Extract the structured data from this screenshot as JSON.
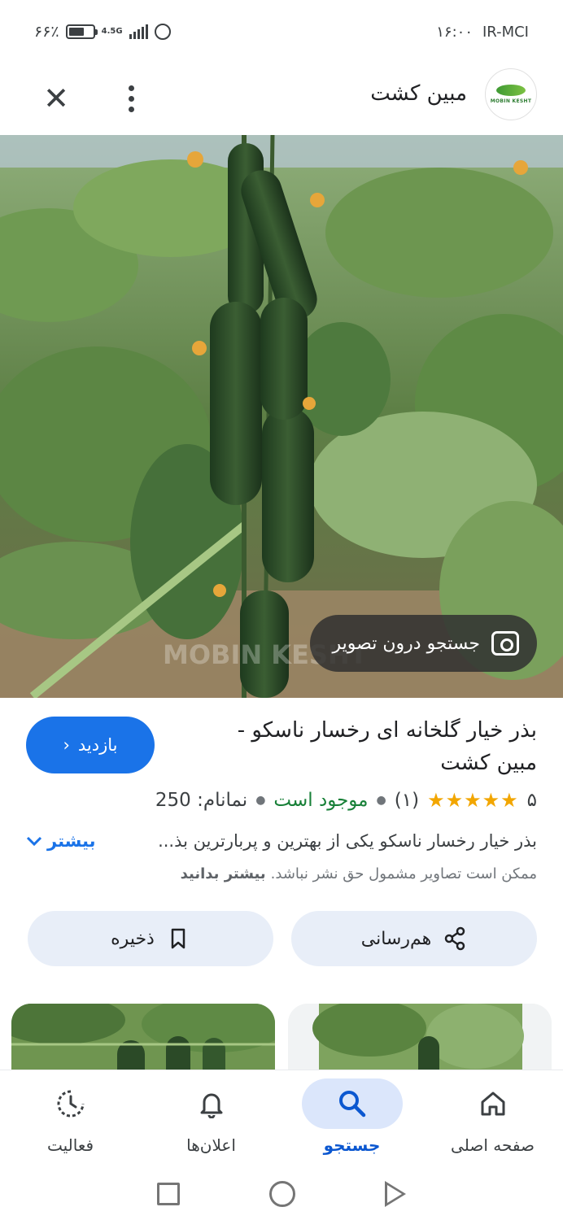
{
  "status_bar": {
    "battery_text": "۶۶٪",
    "battery_level": 0.66,
    "network": "4.5G",
    "time": "۱۶:۰۰",
    "carrier": "IR-MCI"
  },
  "header": {
    "site_name": "مبین کشت",
    "logo_text": "MOBIN KESHT",
    "close_icon": "close-icon",
    "more_icon": "more-vert-icon"
  },
  "image": {
    "lens_label": "جستجو درون تصویر",
    "watermark": "MOBIN KESHT"
  },
  "result": {
    "title": "بذر خیار گلخانه ای رخسار ناسکو - مبین کشت",
    "visit_label": "بازدید",
    "rating": "۵",
    "stars": "★★★★★",
    "reviews": "(۱)",
    "availability": "موجود است",
    "price": "نمانام: 250",
    "description": "بذر خیار رخسار ناسکو یکی از بهترین و پربارترین بذ...",
    "more_label": "بیشتر",
    "copyright_notice": "ممکن است تصاویر مشمول حق نشر نباشد.",
    "learn_more": "بیشتر بدانید"
  },
  "actions": {
    "share_label": "هم‌رسانی",
    "save_label": "ذخیره"
  },
  "bottom_nav": {
    "home": "صفحه اصلی",
    "search": "جستجو",
    "notifications": "اعلان‌ها",
    "activity": "فعالیت"
  },
  "colors": {
    "accent": "#1a73e8",
    "in_stock": "#188038",
    "star": "#f2a600",
    "chip_bg": "#e8eef8"
  }
}
